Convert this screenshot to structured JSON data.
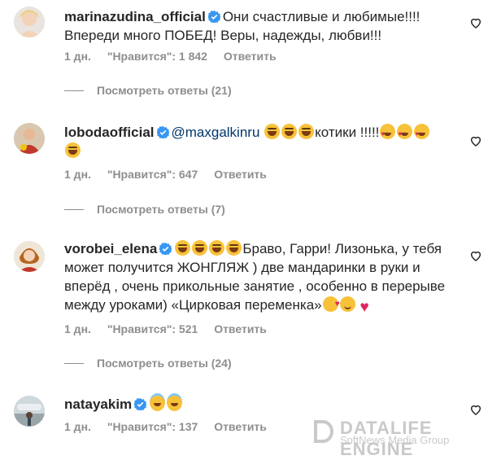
{
  "comments": [
    {
      "username": "marinazudina_official",
      "text_lines": [
        "Они счастливые и любимые!!!!",
        "Впереди много ПОБЕД! Веры, надежды, любви!!!"
      ],
      "time": "1 дн.",
      "likes": "\"Нравится\": 1 842",
      "reply": "Ответить",
      "view_replies": "Посмотреть ответы (21)"
    },
    {
      "username": "lobodaofficial",
      "mention": "@maxgalkinru",
      "text": "котики !!!!!",
      "time": "1 дн.",
      "likes": "\"Нравится\": 647",
      "reply": "Ответить",
      "view_replies": "Посмотреть ответы (7)"
    },
    {
      "username": "vorobei_elena",
      "text_line1": "Браво, Гарри! Лизонька, у тебя",
      "text_line2": "может получится ЖОНГЛЯЖ ) две мандаринки в руки и",
      "text_line3": "вперёд , очень прикольные занятие , особенно в перерыве",
      "text_line4": "между уроками) «Цирковая переменка»",
      "time": "1 дн.",
      "likes": "\"Нравится\": 521",
      "reply": "Ответить",
      "view_replies": "Посмотреть ответы (24)"
    },
    {
      "username": "natayakim",
      "time": "1 дн.",
      "likes": "\"Нравится\": 137",
      "reply": "Ответить"
    }
  ],
  "icons": {
    "verified": "verified-badge-icon",
    "like": "heart-outline-icon"
  },
  "colors": {
    "verified": "#3897f0",
    "mention": "#00376b",
    "meta": "#8e8e8e"
  },
  "watermark": {
    "title": "DATALIFE ENGINE",
    "subtitle": "SoftNews Media Group"
  }
}
